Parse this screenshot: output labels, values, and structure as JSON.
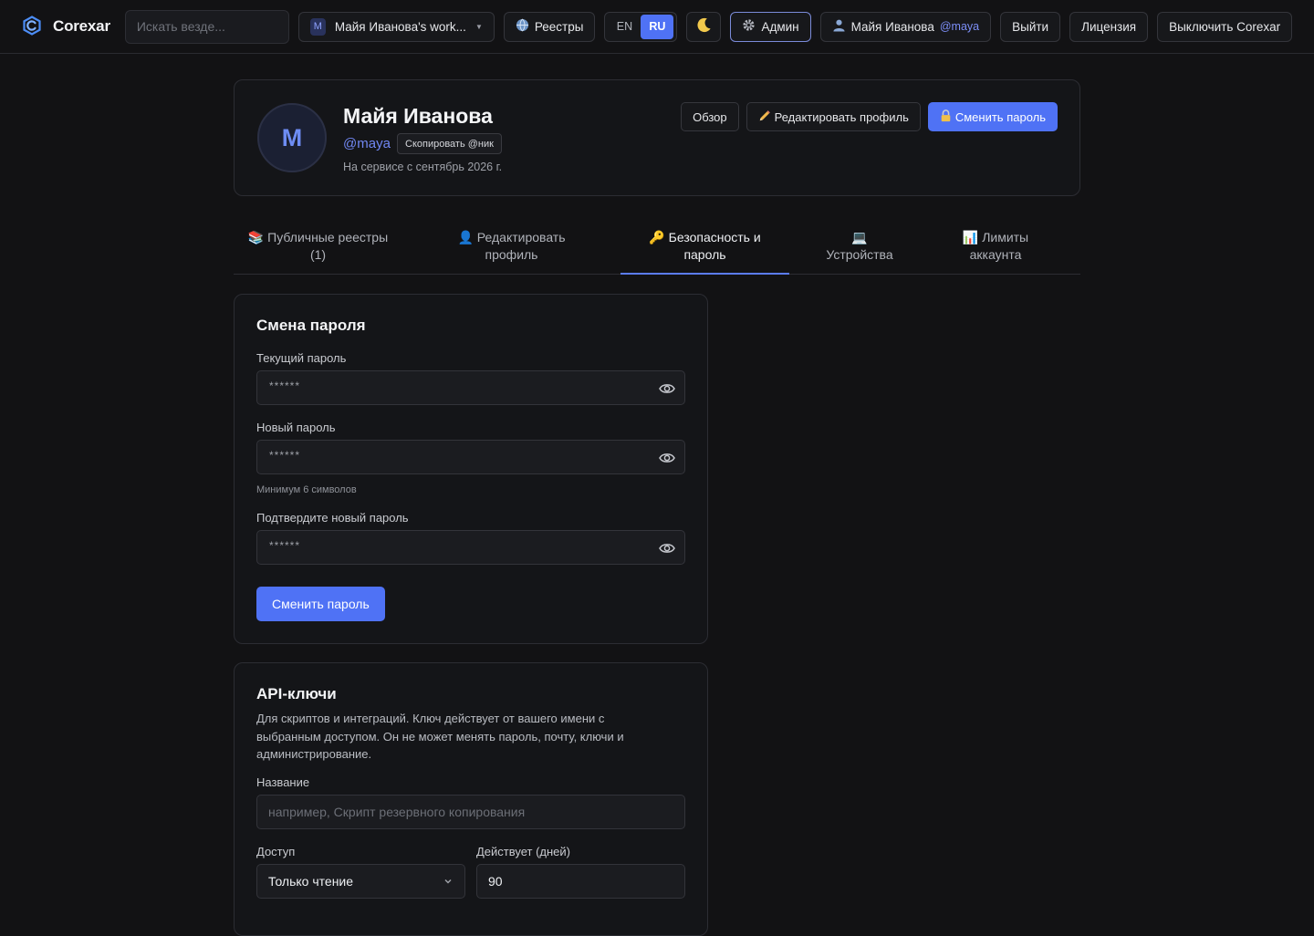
{
  "topbar": {
    "brand": "Corexar",
    "search_placeholder": "Искать везде...",
    "workspace_initial": "M",
    "workspace_label": "Майя Иванова's work...",
    "registries_label": "Реестры",
    "lang_en": "EN",
    "lang_ru": "RU",
    "admin_label": "Админ",
    "user_name": "Майя Иванова",
    "user_handle": "@maya",
    "logout_label": "Выйти",
    "license_label": "Лицензия",
    "shutdown_label": "Выключить Corexar"
  },
  "profile": {
    "avatar_initial": "M",
    "name": "Майя Иванова",
    "handle": "@maya",
    "copy_label": "Скопировать @ник",
    "since": "На сервисе с сентябрь 2026 г.",
    "overview_label": "Обзор",
    "edit_label": "Редактировать профиль",
    "change_pw_label": "Сменить пароль"
  },
  "tabs": {
    "public_line1": "Публичные реестры",
    "public_line2": "(1)",
    "edit_line1": "Редактировать",
    "edit_line2": "профиль",
    "security_line1": "Безопасность и",
    "security_line2": "пароль",
    "devices_label": "Устройства",
    "limits_line1": "Лимиты",
    "limits_line2": "аккаунта"
  },
  "password_card": {
    "title": "Смена пароля",
    "current_label": "Текущий пароль",
    "current_value": "******",
    "new_label": "Новый пароль",
    "new_value": "******",
    "hint": "Минимум 6 символов",
    "confirm_label": "Подтвердите новый пароль",
    "confirm_value": "******",
    "submit_label": "Сменить пароль"
  },
  "api_card": {
    "title": "API-ключи",
    "description": "Для скриптов и интеграций. Ключ действует от вашего имени с выбранным доступом. Он не может менять пароль, почту, ключи и администрирование.",
    "name_label": "Название",
    "name_placeholder": "например, Скрипт резервного копирования",
    "access_label": "Доступ",
    "access_value": "Только чтение",
    "valid_label": "Действует (дней)",
    "valid_value": "90"
  },
  "colors": {
    "background": "#121214",
    "accent": "#4f72f5",
    "handle": "#7187f3"
  }
}
